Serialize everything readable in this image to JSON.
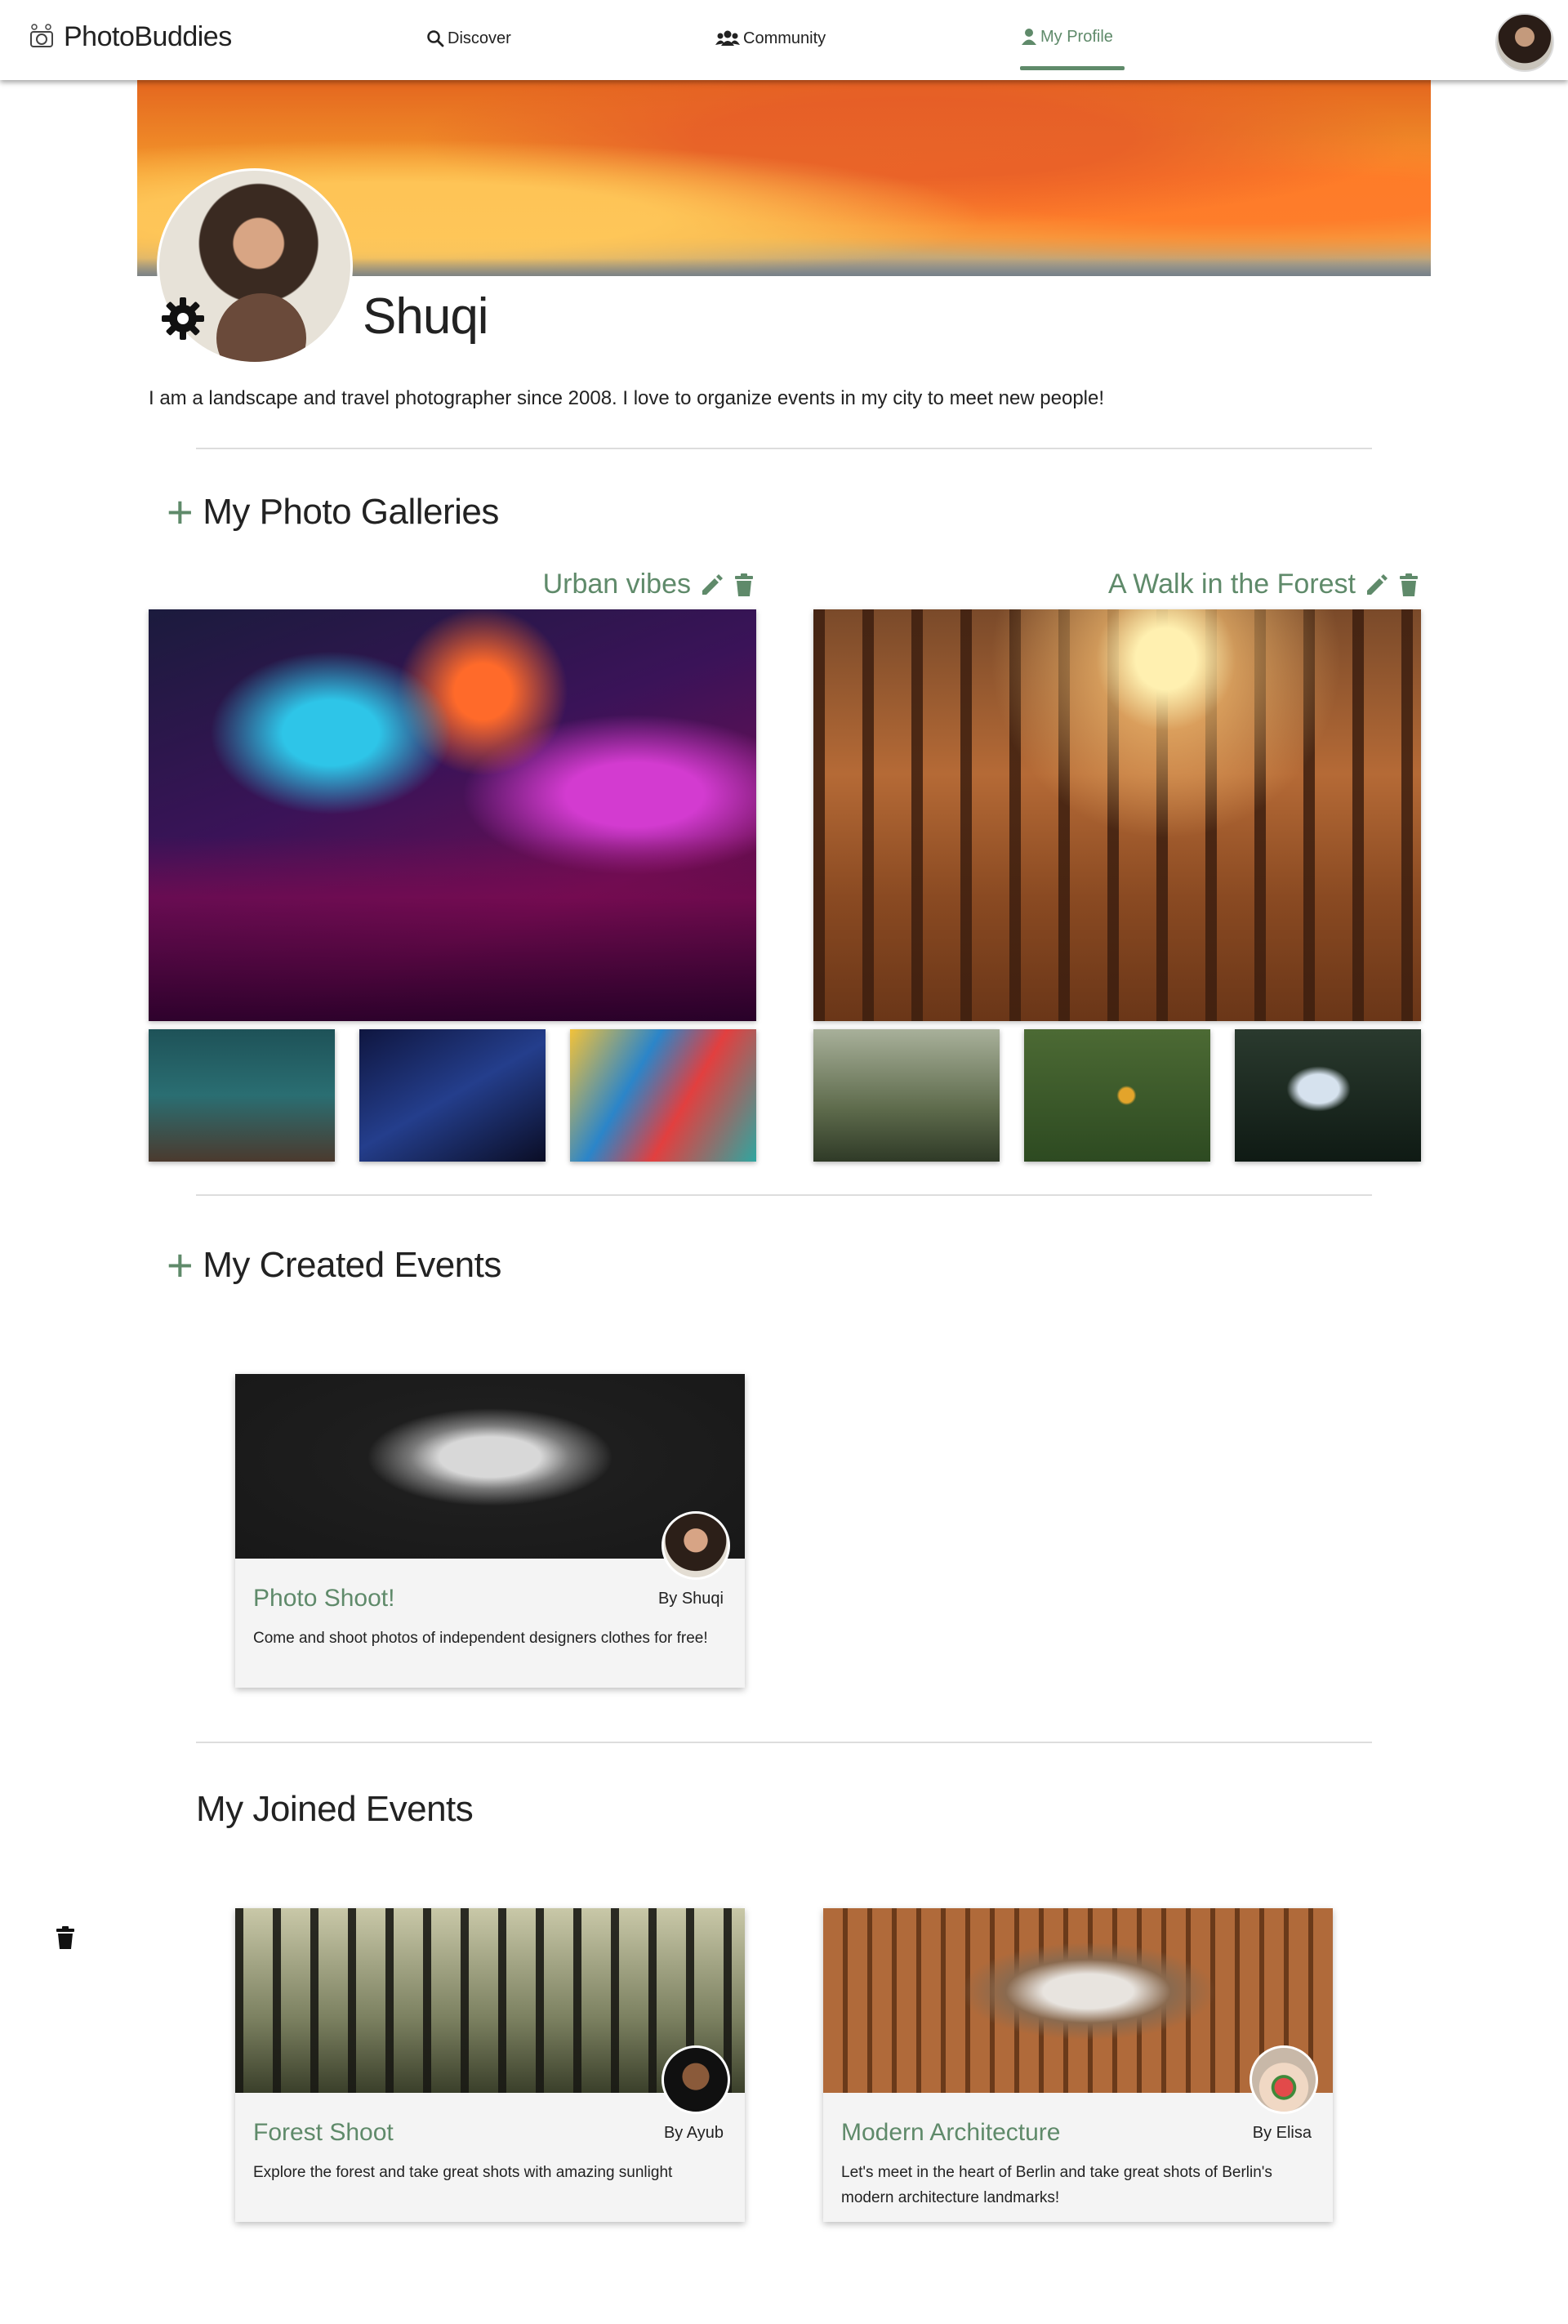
{
  "nav": {
    "brand": "PhotoBuddies",
    "items": [
      {
        "label": "Discover",
        "icon": "search-icon"
      },
      {
        "label": "Community",
        "icon": "users-icon"
      },
      {
        "label": "My Profile",
        "icon": "user-icon",
        "active": true
      }
    ],
    "accent_color": "#5f8a6a"
  },
  "profile": {
    "name": "Shuqi",
    "bio": "I am a landscape and travel photographer since 2008. I love to organize events in my city to meet new people!"
  },
  "galleries_section": {
    "title": "My Photo Galleries",
    "galleries": [
      {
        "title": "Urban vibes",
        "thumbs": 3
      },
      {
        "title": "A Walk in the Forest",
        "thumbs": 3
      }
    ]
  },
  "created_events": {
    "title": "My Created Events",
    "events": [
      {
        "title": "Photo Shoot!",
        "by": "By Shuqi",
        "description": "Come and shoot photos of independent designers clothes for free!"
      }
    ]
  },
  "joined_events": {
    "title": "My Joined Events",
    "events": [
      {
        "title": "Forest Shoot",
        "by": "By Ayub",
        "description": "Explore the forest and take great shots with amazing sunlight"
      },
      {
        "title": "Modern Architecture",
        "by": "By Elisa",
        "description": "Let's meet in the heart of Berlin and take great shots of Berlin's modern architecture landmarks!"
      }
    ]
  }
}
